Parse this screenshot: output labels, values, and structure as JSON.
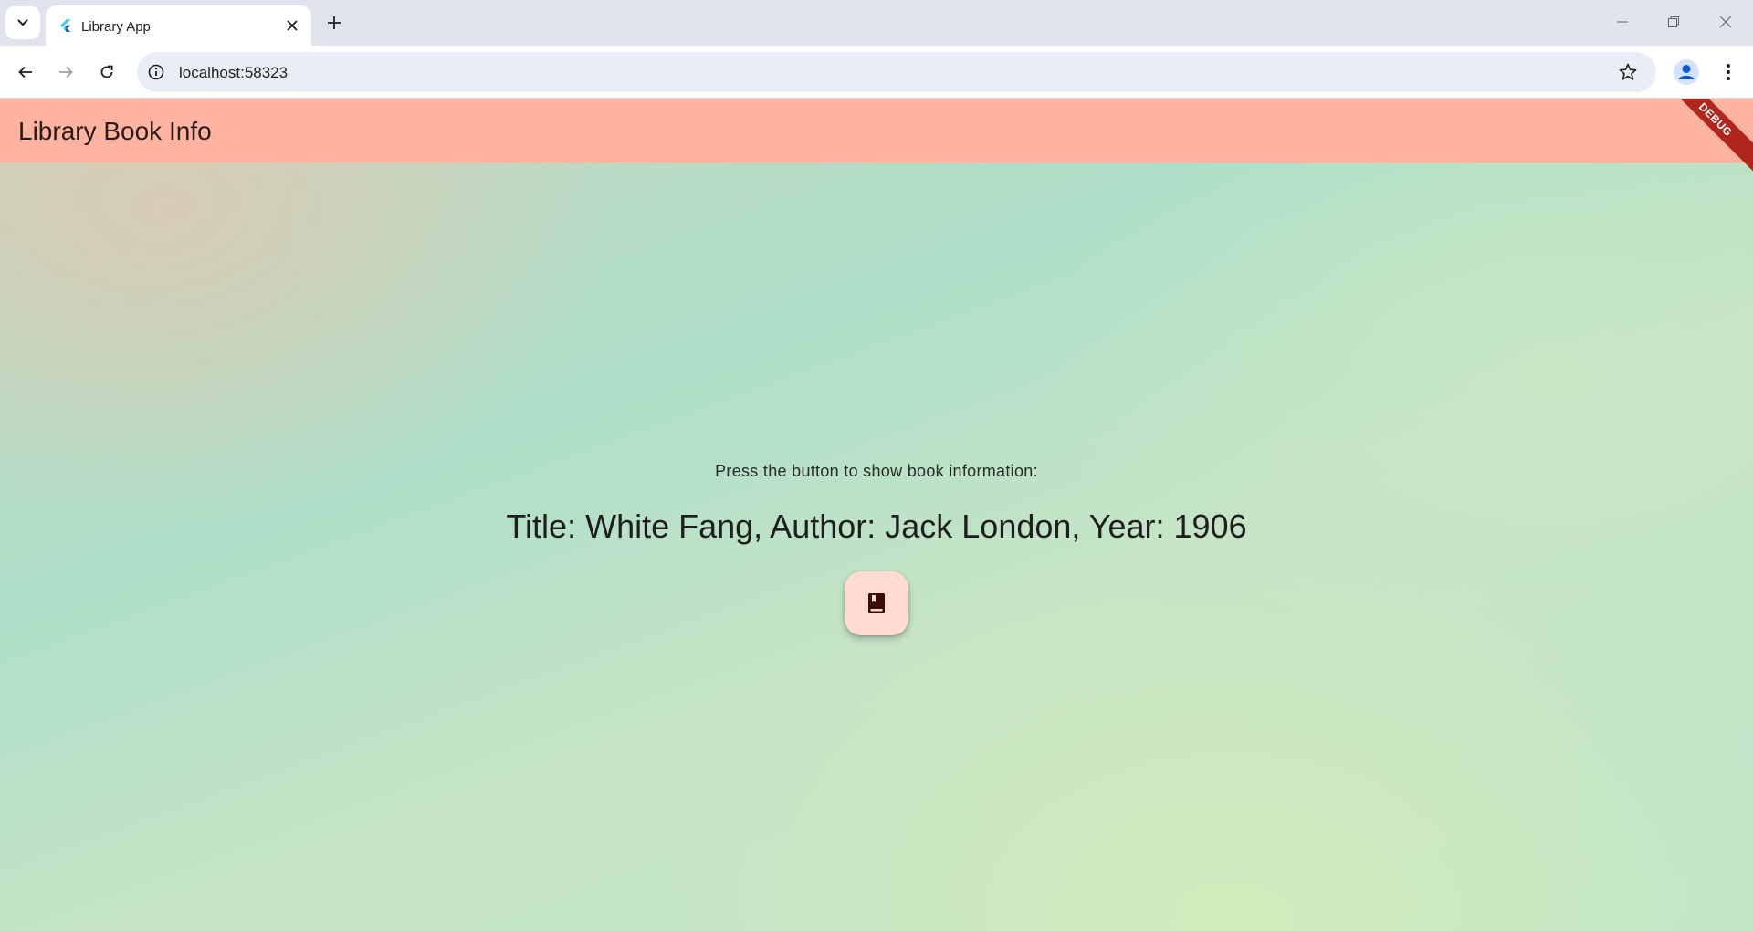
{
  "browser": {
    "tab_title": "Library App",
    "url": "localhost:58323"
  },
  "app": {
    "appbar_title": "Library Book Info",
    "debug_label": "DEBUG",
    "prompt_text": "Press the button to show book information:",
    "book_info": "Title: White Fang, Author: Jack London, Year: 1906",
    "fab_icon": "book-icon"
  },
  "colors": {
    "appbar": "#ffb4a2",
    "fab": "#ffdbd1",
    "debug_banner": "#b3261e"
  }
}
